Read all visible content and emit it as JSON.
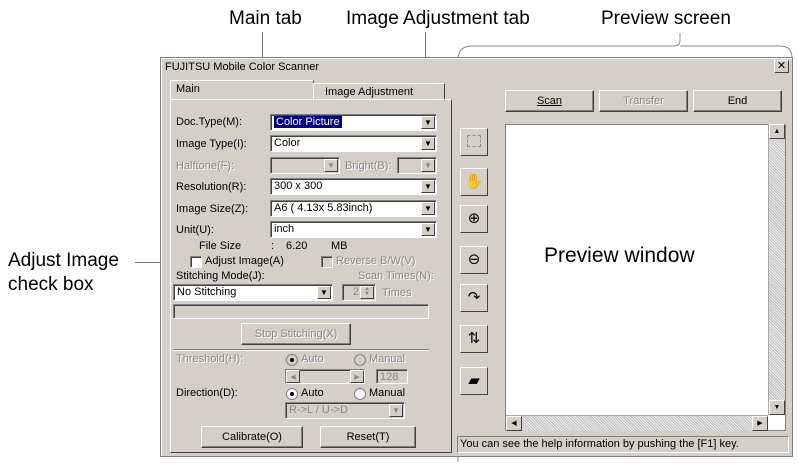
{
  "callouts": {
    "main_tab": "Main tab",
    "image_adjustment_tab": "Image Adjustment tab",
    "preview_screen": "Preview screen",
    "adjust_image_line1": "Adjust Image",
    "adjust_image_line2": "check box",
    "preview_window": "Preview window"
  },
  "window": {
    "title": "FUJITSU Mobile Color Scanner",
    "close_glyph": "✕"
  },
  "tabs": {
    "main": "Main",
    "image_adjustment": "Image Adjustment"
  },
  "form": {
    "doc_type_label": "Doc.Type(M):",
    "doc_type_value": "Color Picture",
    "image_type_label": "Image Type(I):",
    "image_type_value": "Color",
    "halftone_label": "Halftone(F):",
    "bright_label": "Bright(B):",
    "resolution_label": "Resolution(R):",
    "resolution_value": "300 x 300",
    "image_size_label": "Image Size(Z):",
    "image_size_value": "A6 ( 4.13x 5.83inch)",
    "unit_label": "Unit(U):",
    "unit_value": "inch",
    "file_size_label": "File Size",
    "file_size_colon": ":",
    "file_size_value": "6.20",
    "file_size_unit": "MB",
    "adjust_image_label": "Adjust Image(A)",
    "reverse_label": "Reverse B/W(V)",
    "stitching_mode_label": "Stitching Mode(J):",
    "stitching_mode_value": "No Stitching",
    "scan_times_label": "Scan Times(N):",
    "scan_times_value": "2",
    "times_label": "Times",
    "stop_stitching_label": "Stop Stitching(X)",
    "threshold_label": "Threshold(H):",
    "threshold_auto": "Auto",
    "threshold_manual": "Manual",
    "threshold_value": "128",
    "direction_label": "Direction(D):",
    "direction_auto": "Auto",
    "direction_manual": "Manual",
    "direction_value": "R->L / U->D",
    "calibrate_label": "Calibrate(O)",
    "reset_label": "Reset(T)"
  },
  "preview": {
    "scan_label": "Scan",
    "transfer_label": "Transfer",
    "end_label": "End",
    "status_text": "You can see the help information by pushing the [F1] key."
  },
  "tool_icons": [
    "select-icon",
    "hand-icon",
    "zoom-in-icon",
    "zoom-out-icon",
    "rotate-icon",
    "flip-icon",
    "book-icon"
  ]
}
